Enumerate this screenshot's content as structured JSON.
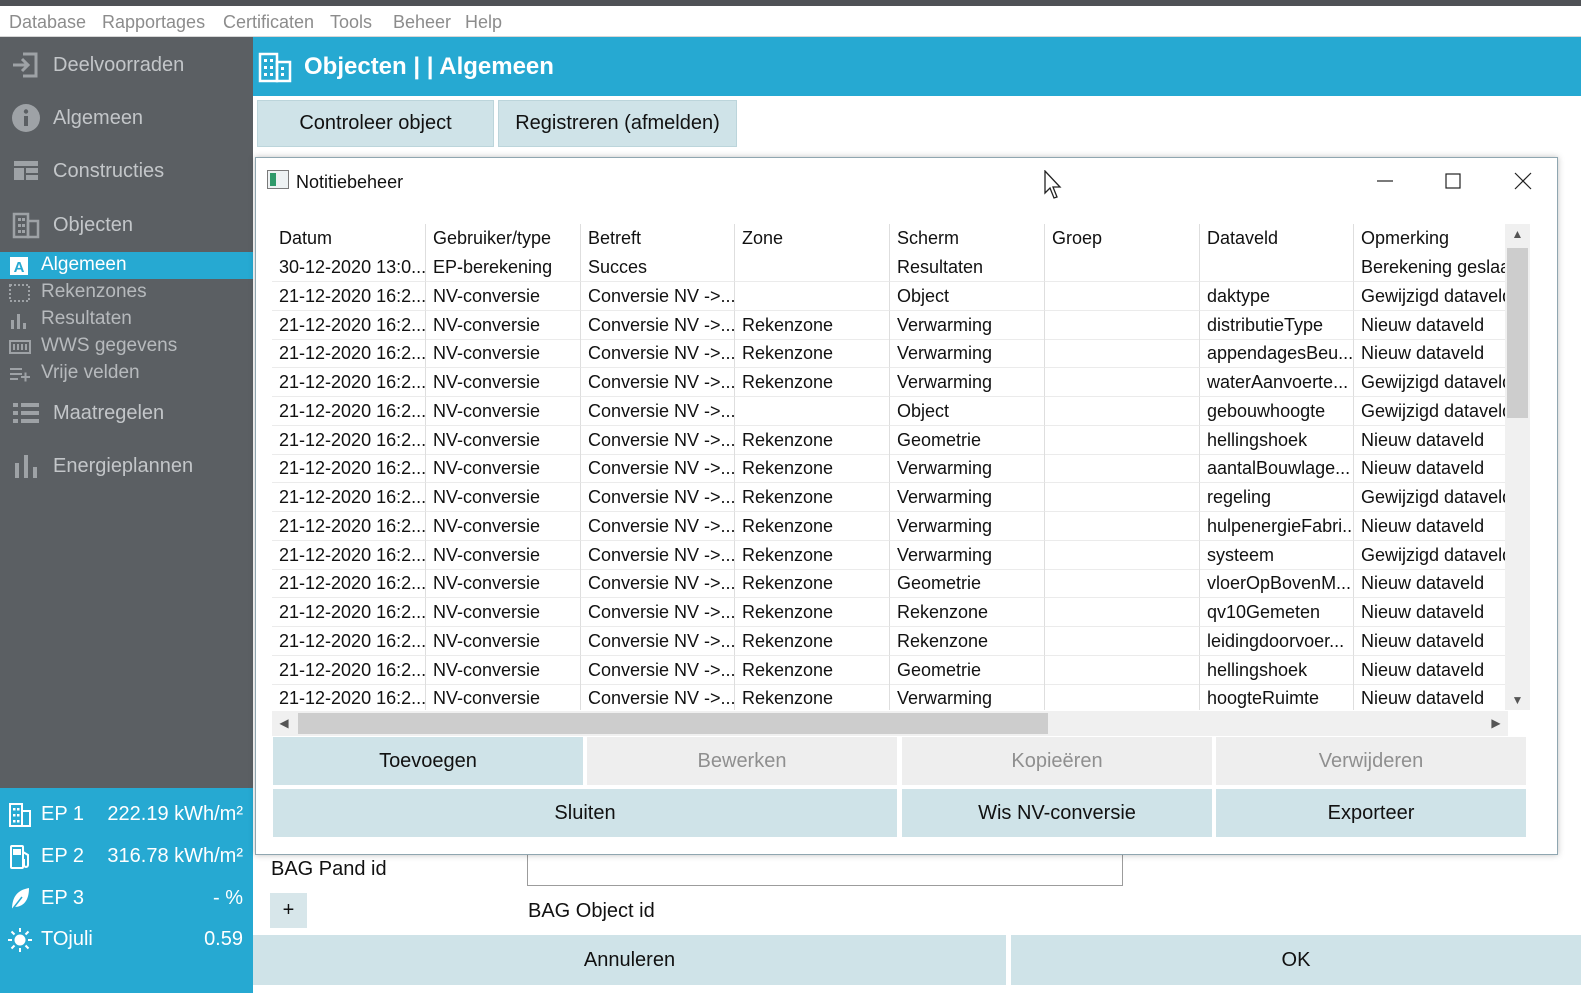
{
  "menu": [
    "Database",
    "Rapportages",
    "Certificaten",
    "Tools",
    "Beheer",
    "Help"
  ],
  "sidebar": {
    "items": [
      {
        "label": "Deelvoorraden",
        "icon": "sign-in-icon"
      },
      {
        "label": "Algemeen",
        "icon": "info-icon"
      },
      {
        "label": "Constructies",
        "icon": "constructies-icon"
      },
      {
        "label": "Objecten",
        "icon": "building-icon"
      }
    ],
    "subitems": [
      {
        "label": "Algemeen",
        "icon": "letter-a-icon",
        "active": true
      },
      {
        "label": "Rekenzones",
        "icon": "dotted-rect-icon",
        "active": false
      },
      {
        "label": "Resultaten",
        "icon": "bar-chart-icon",
        "active": false
      },
      {
        "label": "WWS gegevens",
        "icon": "panel-icon",
        "active": false
      },
      {
        "label": "Vrije velden",
        "icon": "list-add-icon",
        "active": false
      }
    ],
    "items2": [
      {
        "label": "Maatregelen",
        "icon": "list-icon"
      },
      {
        "label": "Energieplannen",
        "icon": "bar-chart-icon"
      }
    ]
  },
  "ep": [
    {
      "name": "EP 1",
      "value": "222.19 kWh/m²",
      "icon": "building-icon"
    },
    {
      "name": "EP 2",
      "value": "316.78 kWh/m²",
      "icon": "fuel-pump-icon"
    },
    {
      "name": "EP 3",
      "value": "- %",
      "icon": "leaf-icon"
    },
    {
      "name": "TOjuli",
      "value": "0.59",
      "icon": "sun-icon"
    }
  ],
  "header": {
    "title": "Objecten |  | Algemeen"
  },
  "toolbar": {
    "check_label": "Controleer object",
    "register_label": "Registreren (afmelden)"
  },
  "background_form": {
    "bag_pand_label": "BAG Pand id",
    "bag_object_label": "BAG Object id",
    "plus_label": "+"
  },
  "bottom": {
    "cancel_label": "Annuleren",
    "ok_label": "OK"
  },
  "dialog": {
    "title": "Notitiebeheer",
    "columns": [
      "Datum",
      "Gebruiker/type",
      "Betreft",
      "Zone",
      "Scherm",
      "Groep",
      "Dataveld",
      "Opmerking"
    ],
    "rows": [
      [
        "30-12-2020 13:0...",
        "EP-berekening",
        "Succes",
        "",
        "Resultaten",
        "",
        "",
        "Berekening geslaa"
      ],
      [
        "21-12-2020 16:2...",
        "NV-conversie",
        "Conversie NV ->...",
        "",
        "Object",
        "",
        "daktype",
        "Gewijzigd dataveld"
      ],
      [
        "21-12-2020 16:2...",
        "NV-conversie",
        "Conversie NV ->...",
        "Rekenzone",
        "Verwarming",
        "",
        "distributieType",
        "Nieuw dataveld"
      ],
      [
        "21-12-2020 16:2...",
        "NV-conversie",
        "Conversie NV ->...",
        "Rekenzone",
        "Verwarming",
        "",
        "appendagesBeu...",
        "Nieuw dataveld"
      ],
      [
        "21-12-2020 16:2...",
        "NV-conversie",
        "Conversie NV ->...",
        "Rekenzone",
        "Verwarming",
        "",
        "waterAanvoerte...",
        "Gewijzigd dataveld"
      ],
      [
        "21-12-2020 16:2...",
        "NV-conversie",
        "Conversie NV ->...",
        "",
        "Object",
        "",
        "gebouwhoogte",
        "Gewijzigd dataveld"
      ],
      [
        "21-12-2020 16:2...",
        "NV-conversie",
        "Conversie NV ->...",
        "Rekenzone",
        "Geometrie",
        "",
        "hellingshoek",
        "Nieuw dataveld"
      ],
      [
        "21-12-2020 16:2...",
        "NV-conversie",
        "Conversie NV ->...",
        "Rekenzone",
        "Verwarming",
        "",
        "aantalBouwlage...",
        "Nieuw dataveld"
      ],
      [
        "21-12-2020 16:2...",
        "NV-conversie",
        "Conversie NV ->...",
        "Rekenzone",
        "Verwarming",
        "",
        "regeling",
        "Gewijzigd dataveld"
      ],
      [
        "21-12-2020 16:2...",
        "NV-conversie",
        "Conversie NV ->...",
        "Rekenzone",
        "Verwarming",
        "",
        "hulpenergieFabri...",
        "Nieuw dataveld"
      ],
      [
        "21-12-2020 16:2...",
        "NV-conversie",
        "Conversie NV ->...",
        "Rekenzone",
        "Verwarming",
        "",
        "systeem",
        "Gewijzigd dataveld"
      ],
      [
        "21-12-2020 16:2...",
        "NV-conversie",
        "Conversie NV ->...",
        "Rekenzone",
        "Geometrie",
        "",
        "vloerOpBovenM...",
        "Nieuw dataveld"
      ],
      [
        "21-12-2020 16:2...",
        "NV-conversie",
        "Conversie NV ->...",
        "Rekenzone",
        "Rekenzone",
        "",
        "qv10Gemeten",
        "Nieuw dataveld"
      ],
      [
        "21-12-2020 16:2...",
        "NV-conversie",
        "Conversie NV ->...",
        "Rekenzone",
        "Rekenzone",
        "",
        "leidingdoorvoer...",
        "Nieuw dataveld"
      ],
      [
        "21-12-2020 16:2...",
        "NV-conversie",
        "Conversie NV ->...",
        "Rekenzone",
        "Geometrie",
        "",
        "hellingshoek",
        "Nieuw dataveld"
      ],
      [
        "21-12-2020 16:2...",
        "NV-conversie",
        "Conversie NV ->...",
        "Rekenzone",
        "Verwarming",
        "",
        "hoogteRuimte",
        "Nieuw dataveld"
      ]
    ],
    "buttons_row1": [
      {
        "label": "Toevoegen",
        "enabled": true
      },
      {
        "label": "Bewerken",
        "enabled": false
      },
      {
        "label": "Kopieëren",
        "enabled": false
      },
      {
        "label": "Verwijderen",
        "enabled": false
      }
    ],
    "buttons_row2": [
      {
        "label": "Sluiten",
        "enabled": true
      },
      {
        "label": "Wis NV-conversie",
        "enabled": true
      },
      {
        "label": "Exporteer",
        "enabled": true
      }
    ]
  }
}
